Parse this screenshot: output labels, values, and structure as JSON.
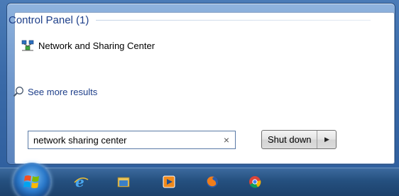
{
  "results": {
    "group_title": "Control Panel (1)",
    "item_label": "Network and Sharing Center",
    "see_more_label": "See more results"
  },
  "search": {
    "value": "network sharing center",
    "clear_glyph": "×"
  },
  "power": {
    "shutdown_label": "Shut down",
    "arrow_glyph": "▶"
  },
  "taskbar": {
    "apps": [
      "internet-explorer",
      "file-explorer",
      "media-player",
      "firefox",
      "chrome"
    ]
  }
}
